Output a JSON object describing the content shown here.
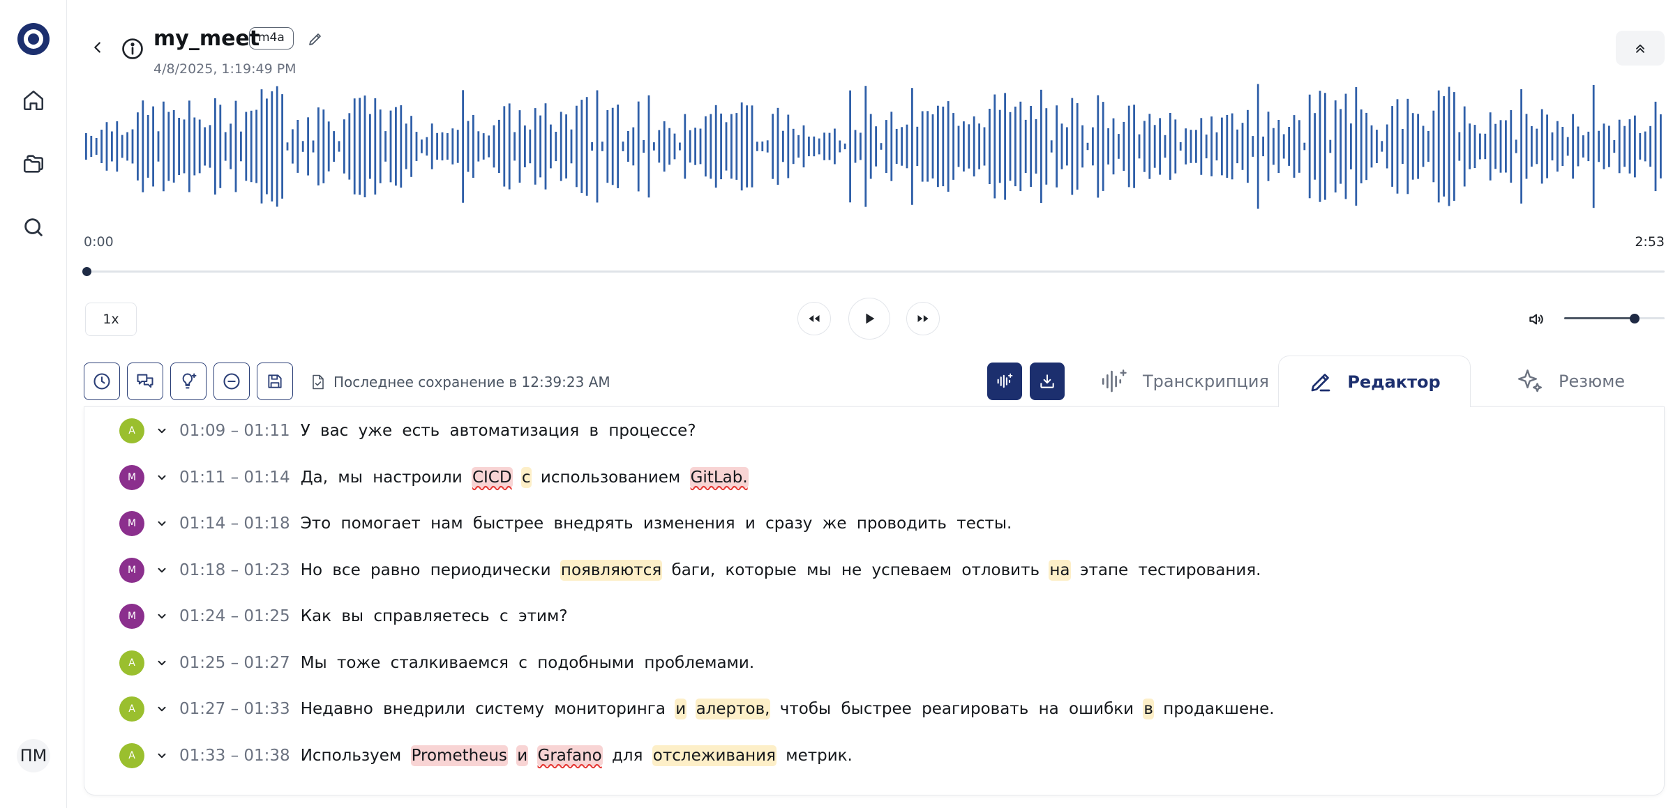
{
  "sidebar": {
    "logo_icon": "logo-ring-icon",
    "items": [
      {
        "name": "home",
        "icon": "home-icon"
      },
      {
        "name": "folders",
        "icon": "folders-icon"
      },
      {
        "name": "search",
        "icon": "search-icon"
      }
    ],
    "user_initials": "ПМ"
  },
  "header": {
    "title": "my_meet",
    "format": "m4a",
    "date": "4/8/2025, 1:19:49 PM"
  },
  "player": {
    "time_start": "0:00",
    "time_end": "2:53",
    "progress": 0.0,
    "speed": "1x",
    "volume": 0.7
  },
  "toolbar": {
    "last_saved": "Последнее сохранение в 12:39:23 AM"
  },
  "tabs": [
    {
      "label": "Транскрипция",
      "active": false
    },
    {
      "label": "Редактор",
      "active": true
    },
    {
      "label": "Резюме",
      "active": false
    }
  ],
  "colors": {
    "accent": "#1c2f6e",
    "waveform": "#2f5fa8",
    "speaker_a": "#9abf2e",
    "speaker_m": "#8b2f8d",
    "highlight_warning": "#fdefc8",
    "highlight_error": "#f8d4d4"
  },
  "segments": [
    {
      "speaker": "А",
      "time": "01:09 – 01:11",
      "words": [
        {
          "t": "У"
        },
        {
          "t": "вас"
        },
        {
          "t": "уже"
        },
        {
          "t": "есть"
        },
        {
          "t": "автоматизация"
        },
        {
          "t": "в"
        },
        {
          "t": "процессе?"
        }
      ]
    },
    {
      "speaker": "М",
      "time": "01:11 – 01:14",
      "words": [
        {
          "t": "Да,"
        },
        {
          "t": "мы"
        },
        {
          "t": "настроили"
        },
        {
          "t": "CICD",
          "hl": "r",
          "sq": true
        },
        {
          "t": "с",
          "hl": "y"
        },
        {
          "t": "использованием"
        },
        {
          "t": "GitLab.",
          "hl": "r",
          "sq": true
        }
      ]
    },
    {
      "speaker": "М",
      "time": "01:14 – 01:18",
      "words": [
        {
          "t": "Это"
        },
        {
          "t": "помогает"
        },
        {
          "t": "нам"
        },
        {
          "t": "быстрее"
        },
        {
          "t": "внедрять"
        },
        {
          "t": "изменения"
        },
        {
          "t": "и"
        },
        {
          "t": "сразу"
        },
        {
          "t": "же"
        },
        {
          "t": "проводить"
        },
        {
          "t": "тесты."
        }
      ]
    },
    {
      "speaker": "М",
      "time": "01:18 – 01:23",
      "words": [
        {
          "t": "Но"
        },
        {
          "t": "все"
        },
        {
          "t": "равно"
        },
        {
          "t": "периодически"
        },
        {
          "t": "появляются",
          "hl": "y"
        },
        {
          "t": "баги,"
        },
        {
          "t": "которые"
        },
        {
          "t": "мы"
        },
        {
          "t": "не"
        },
        {
          "t": "успеваем"
        },
        {
          "t": "отловить"
        },
        {
          "t": "на",
          "hl": "y"
        },
        {
          "t": "этапе"
        },
        {
          "t": "тестирования."
        }
      ]
    },
    {
      "speaker": "М",
      "time": "01:24 – 01:25",
      "words": [
        {
          "t": "Как"
        },
        {
          "t": "вы"
        },
        {
          "t": "справляетесь"
        },
        {
          "t": "с"
        },
        {
          "t": "этим?"
        }
      ]
    },
    {
      "speaker": "А",
      "time": "01:25 – 01:27",
      "words": [
        {
          "t": "Мы"
        },
        {
          "t": "тоже"
        },
        {
          "t": "сталкиваемся"
        },
        {
          "t": "с"
        },
        {
          "t": "подобными"
        },
        {
          "t": "проблемами."
        }
      ]
    },
    {
      "speaker": "А",
      "time": "01:27 – 01:33",
      "words": [
        {
          "t": "Недавно"
        },
        {
          "t": "внедрили"
        },
        {
          "t": "систему"
        },
        {
          "t": "мониторинга"
        },
        {
          "t": "и",
          "hl": "y"
        },
        {
          "t": "алертов,",
          "hl": "y"
        },
        {
          "t": "чтобы"
        },
        {
          "t": "быстрее"
        },
        {
          "t": "реагировать"
        },
        {
          "t": "на"
        },
        {
          "t": "ошибки"
        },
        {
          "t": "в",
          "hl": "y"
        },
        {
          "t": "продакшене."
        }
      ]
    },
    {
      "speaker": "А",
      "time": "01:33 – 01:38",
      "words": [
        {
          "t": "Используем"
        },
        {
          "t": "Prometheus",
          "hl": "r"
        },
        {
          "t": "и",
          "hl": "r"
        },
        {
          "t": "Grafano",
          "hl": "r",
          "sq": true
        },
        {
          "t": "для"
        },
        {
          "t": "отслеживания",
          "hl": "y"
        },
        {
          "t": "метрик."
        }
      ]
    }
  ]
}
